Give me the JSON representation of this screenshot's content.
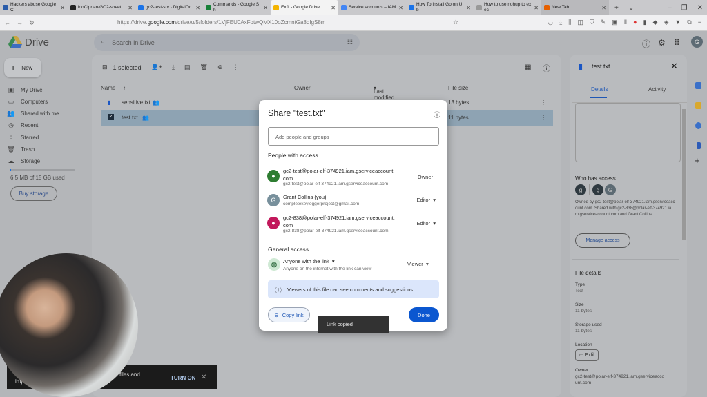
{
  "browser": {
    "tabs": [
      {
        "label": "Hackers abuse Google C",
        "color": "#2a5caa"
      },
      {
        "label": "looCiprian/GC2-sheet:",
        "color": "#222"
      },
      {
        "label": "gc2-test-srv - DigitalOc",
        "color": "#1a73e8"
      },
      {
        "label": "Commands - Google Sh",
        "color": "#188038"
      },
      {
        "label": "Exfil - Google Drive",
        "color": "#f4b400",
        "active": true
      },
      {
        "label": "Service accounts – IAM",
        "color": "#4285f4"
      },
      {
        "label": "How To Install Go on Ub",
        "color": "#1a73e8"
      },
      {
        "label": "How to use nohup to exec",
        "color": "#999"
      },
      {
        "label": "New Tab",
        "color": "#e66000",
        "newtab": true
      }
    ],
    "url_prefix": "https://drive.",
    "url_domain": "google.com",
    "url_path": "/drive/u/5/folders/1VjFEU0AxFotwQMX10oZcmntGa8dIgS8m"
  },
  "drive": {
    "logo_text": "Drive",
    "search_placeholder": "Search in Drive",
    "avatar_letter": "G",
    "new_label": "New",
    "nav": [
      {
        "label": "My Drive",
        "icon": "my-drive-icon",
        "glyph": "▣"
      },
      {
        "label": "Computers",
        "icon": "computers-icon",
        "glyph": "▭"
      },
      {
        "label": "Shared with me",
        "icon": "shared-icon",
        "glyph": "👥"
      },
      {
        "label": "Recent",
        "icon": "clock-icon",
        "glyph": "◷"
      },
      {
        "label": "Starred",
        "icon": "star-icon",
        "glyph": "☆"
      },
      {
        "label": "Trash",
        "icon": "trash-icon",
        "glyph": "🗑"
      },
      {
        "label": "Storage",
        "icon": "cloud-icon",
        "glyph": "☁"
      }
    ],
    "storage_used": "6.5 MB of 15 GB used",
    "storage_fraction": 0.0004,
    "buy_storage": "Buy storage",
    "toolbar": {
      "selected": "1 selected"
    },
    "columns": {
      "name": "Name",
      "owner": "Owner",
      "modified": "Last modified",
      "size": "File size"
    },
    "files": [
      {
        "name": "sensitive.txt",
        "size": "13 bytes",
        "selected": false
      },
      {
        "name": "test.txt",
        "size": "11 bytes",
        "selected": true
      }
    ]
  },
  "details": {
    "title": "test.txt",
    "tabs": [
      "Details",
      "Activity"
    ],
    "who_has_access": "Who has access",
    "avatars": [
      "g",
      "g",
      "G"
    ],
    "access_text": "Owned by gc2-test@polar-elf-374921.iam.gserviceaccount.com. Shared with gc2-838@polar-elf-374921.iam.gserviceaccount.com and Grant Collins.",
    "manage_access": "Manage access",
    "file_details": "File details",
    "fields": [
      {
        "label": "Type",
        "value": "Text"
      },
      {
        "label": "Size",
        "value": "11 bytes"
      },
      {
        "label": "Storage used",
        "value": "11 bytes"
      }
    ],
    "location_label": "Location",
    "location_value": "Exfil",
    "owner_label": "Owner",
    "owner_value": "gc2-test@polar-elf-374921.iam.gserviceaccount.com"
  },
  "share": {
    "title": "Share \"test.txt\"",
    "input_placeholder": "Add people and groups",
    "people_heading": "People with access",
    "people": [
      {
        "name": "gc2-test@polar-elf-374921.iam.gserviceaccount.com",
        "email": "gc2-test@polar-elf-374921.iam.gserviceaccount.com",
        "role": "Owner",
        "avatar_color": "#2e7d32",
        "letter": ""
      },
      {
        "name": "Grant Collins (you)",
        "email": "completekeyloggerproject@gmail.com",
        "role": "Editor",
        "avatar_color": "#78909c",
        "letter": "G"
      },
      {
        "name": "gc2-838@polar-elf-374921.iam.gserviceaccount.com",
        "email": "gc2-838@polar-elf-374921.iam.gserviceaccount.com",
        "role": "Editor",
        "avatar_color": "#c2185b",
        "letter": ""
      }
    ],
    "general_heading": "General access",
    "general_access": "Anyone with the link",
    "general_desc": "Anyone on the internet with the link can view",
    "general_role": "Viewer",
    "info": "Viewers of this file can see comments and suggestions",
    "copy_link": "Copy link",
    "done": "Done"
  },
  "snackbar": "Link copied",
  "banner": {
    "text_a": "C",
    "text_b": "files and",
    "text_c": "imp",
    "turn_on": "TURN ON"
  }
}
